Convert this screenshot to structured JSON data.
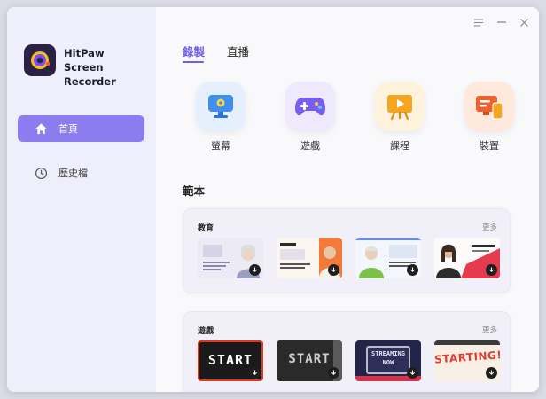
{
  "app": {
    "name_line1": "HitPaw",
    "name_line2": "Screen Recorder"
  },
  "sidebar": {
    "items": [
      {
        "label": "首頁",
        "icon": "home-icon",
        "active": true
      },
      {
        "label": "歷史檔",
        "icon": "history-clock-icon",
        "active": false
      }
    ]
  },
  "window_controls": [
    "menu-icon",
    "minimize-icon",
    "close-icon"
  ],
  "tabs": [
    {
      "label": "錄製",
      "active": true
    },
    {
      "label": "直播",
      "active": false
    }
  ],
  "modes": [
    {
      "label": "螢幕",
      "icon": "monitor-icon",
      "color": "#3f8ff0"
    },
    {
      "label": "遊戲",
      "icon": "gamepad-icon",
      "color": "#7b5cf0"
    },
    {
      "label": "課程",
      "icon": "presentation-icon",
      "color": "#f5a51f"
    },
    {
      "label": "裝置",
      "icon": "devices-icon",
      "color": "#f25f2b"
    }
  ],
  "templates": {
    "title": "範本",
    "sections": [
      {
        "title": "教育",
        "more": "更多"
      },
      {
        "title": "遊戲",
        "more": "更多"
      }
    ],
    "game_thumbs": [
      "START",
      "START",
      "STREAMING NOW",
      "STARTING!"
    ]
  },
  "colors": {
    "accent": "#8c7cf0",
    "accent_text": "#6f5ee8"
  }
}
